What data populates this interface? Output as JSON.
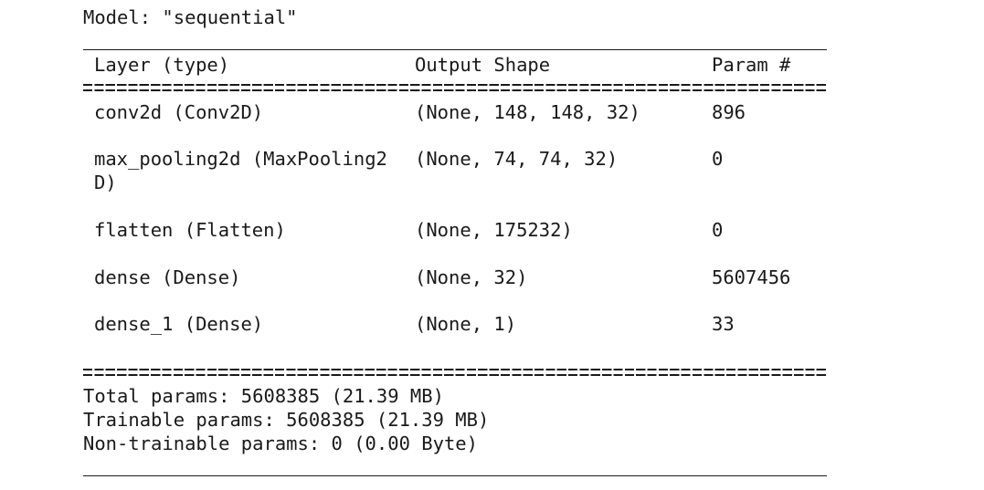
{
  "model": {
    "title": "Model: \"sequential\""
  },
  "table": {
    "headers": {
      "layer": "Layer (type)",
      "output": "Output Shape",
      "params": "Param #"
    },
    "rows": [
      {
        "layer": "conv2d (Conv2D)",
        "output": "(None, 148, 148, 32)",
        "params": "896"
      },
      {
        "layer": "max_pooling2d (MaxPooling2",
        "layer_cont": "D)",
        "output": "(None, 74, 74, 32)",
        "params": "0"
      },
      {
        "layer": "flatten (Flatten)",
        "output": "(None, 175232)",
        "params": "0"
      },
      {
        "layer": "dense (Dense)",
        "output": "(None, 32)",
        "params": "5607456"
      },
      {
        "layer": "dense_1 (Dense)",
        "output": "(None, 1)",
        "params": "33"
      }
    ]
  },
  "totals": {
    "total": "Total params: 5608385 (21.39 MB)",
    "trainable": "Trainable params: 5608385 (21.39 MB)",
    "non_trainable": "Non-trainable params: 0 (0.00 Byte)"
  }
}
